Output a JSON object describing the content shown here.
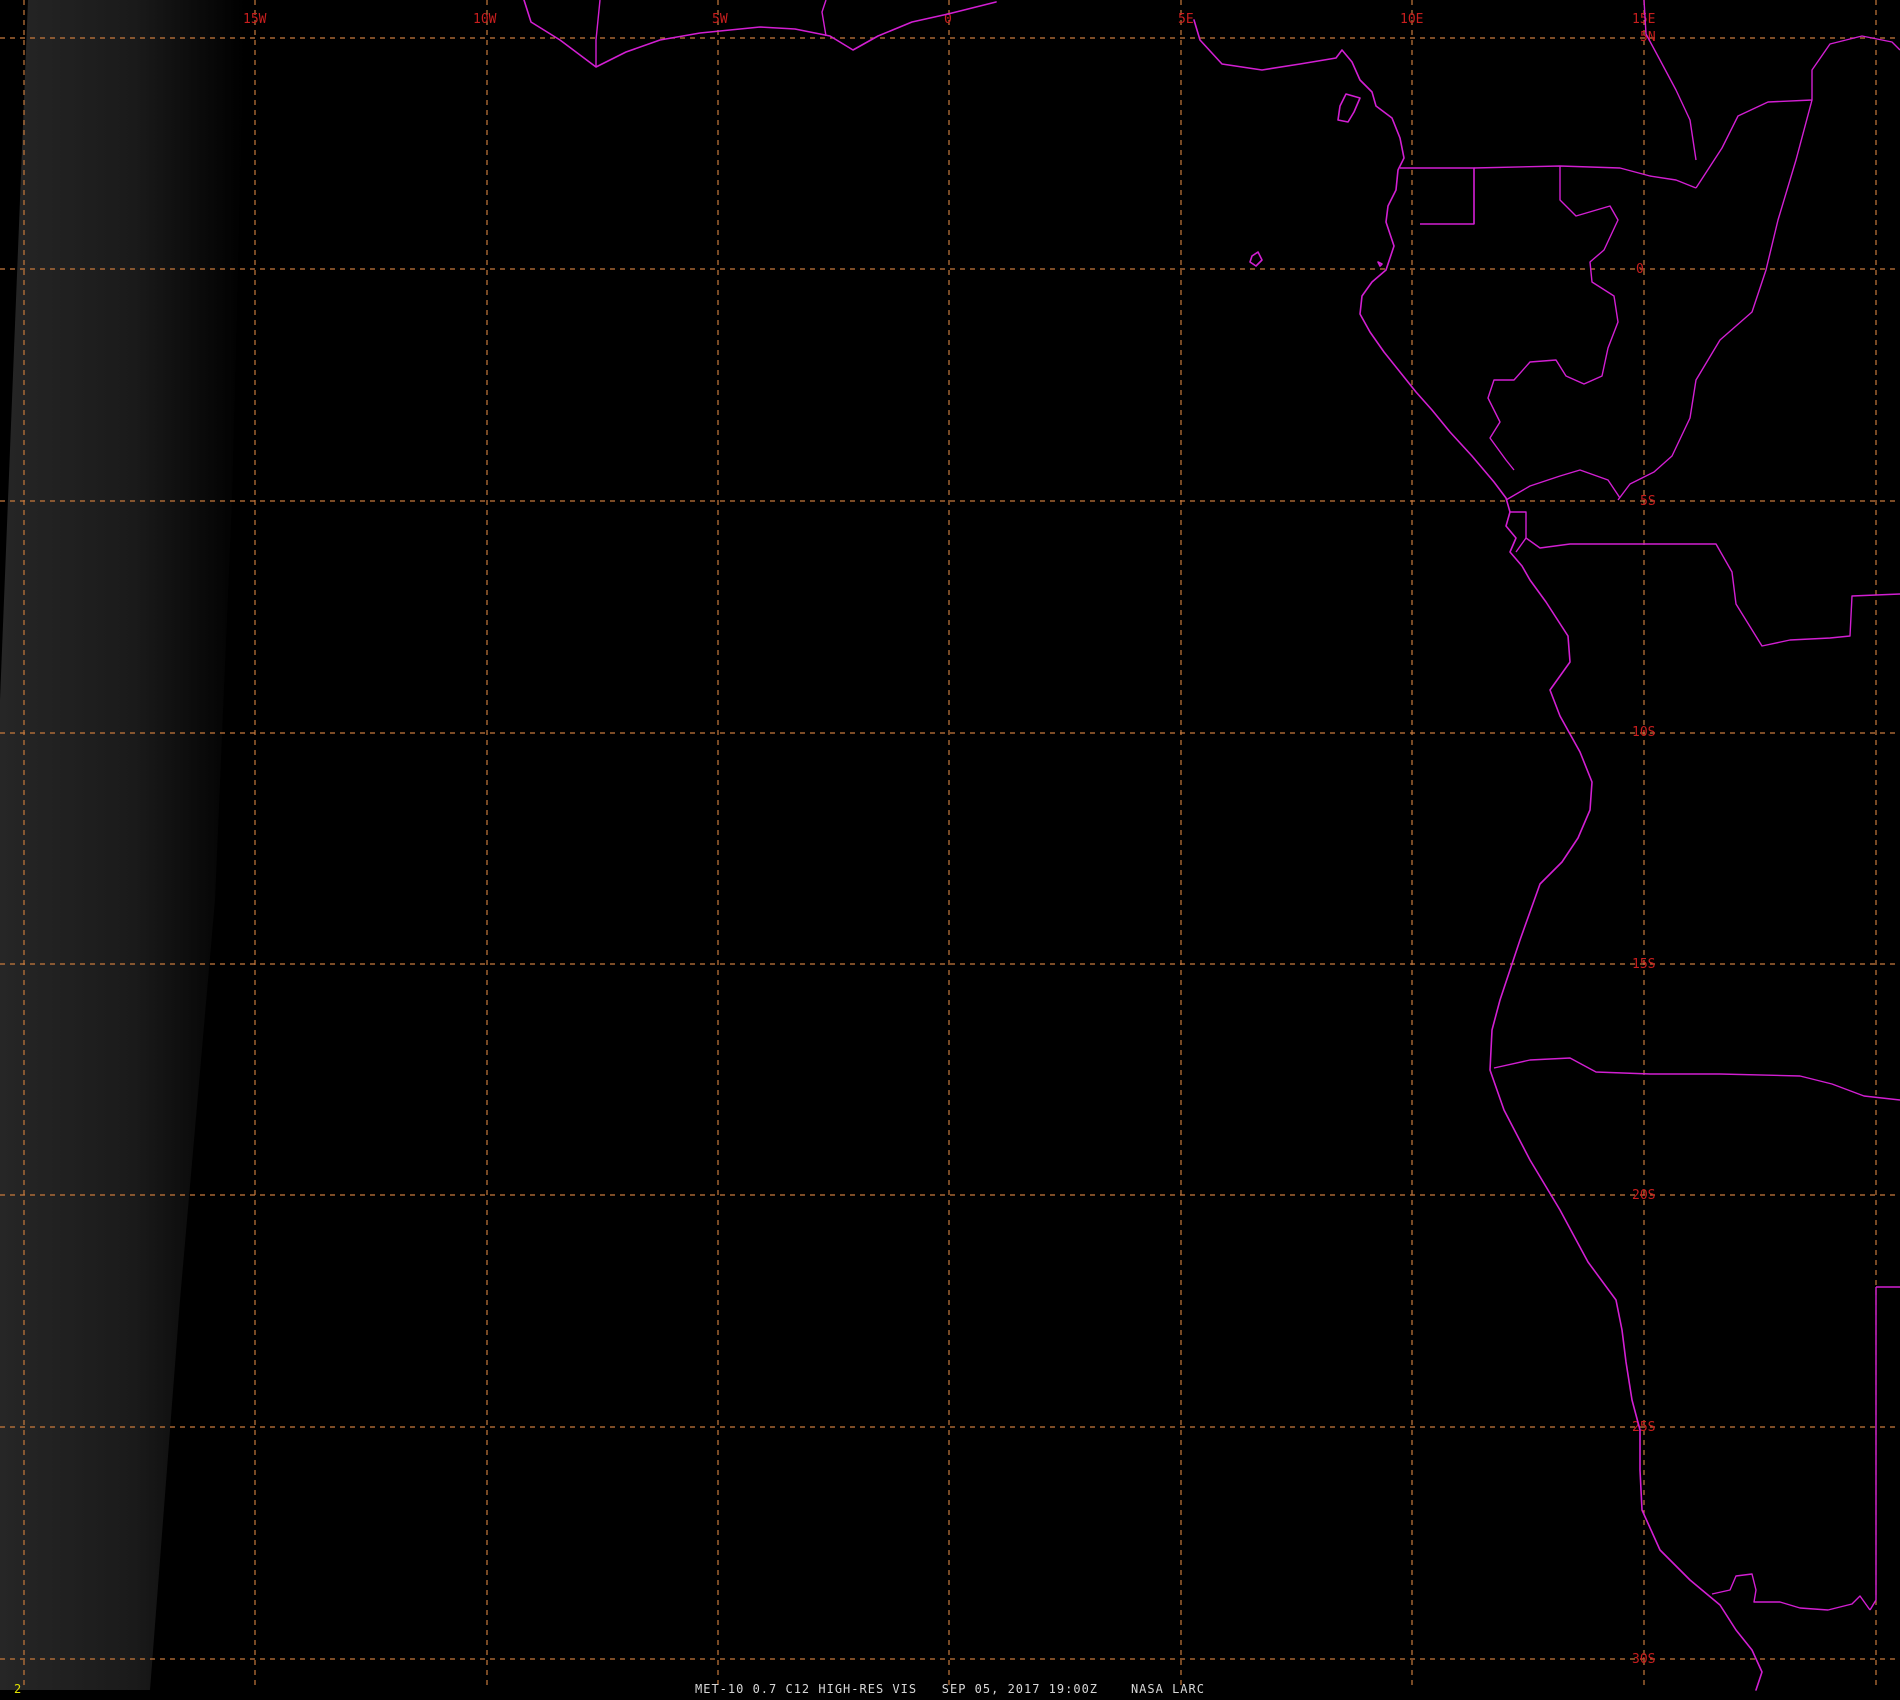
{
  "map": {
    "caption_left": "MET-10 0.7 C12 HIGH-RES VIS",
    "caption_time": "SEP 05, 2017 19:00Z",
    "caption_source": "NASA LARC",
    "frame_number": "2",
    "grid_color": "#c87a3c",
    "label_color": "#c81e1e",
    "boundary_color": "#d21fd2",
    "longitude_labels": [
      "15W",
      "10W",
      "5W",
      "0",
      "5E",
      "10E",
      "15E"
    ],
    "latitude_labels": [
      "5N",
      "0",
      "5S",
      "10S",
      "15S",
      "20S",
      "25S",
      "30S"
    ]
  }
}
